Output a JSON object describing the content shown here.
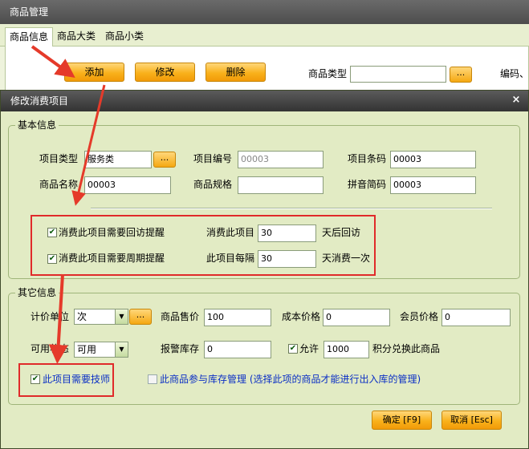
{
  "bg_window": {
    "title": "商品管理",
    "tabs": [
      "商品信息",
      "商品大类",
      "商品小类"
    ],
    "buttons": {
      "add": "添加",
      "edit": "修改",
      "delete": "删除"
    },
    "type_label": "商品类型",
    "code_label": "编码、",
    "dots": "..."
  },
  "dialog": {
    "title": "修改消费项目",
    "close": "×",
    "basic": {
      "title": "基本信息",
      "item_type_label": "项目类型",
      "item_type_value": "服务类",
      "item_no_label": "项目编号",
      "item_no_value": "00003",
      "barcode_label": "项目条码",
      "barcode_value": "00003",
      "name_label": "商品名称",
      "name_value": "00003",
      "spec_label": "商品规格",
      "spec_value": "",
      "pinyin_label": "拼音简码",
      "pinyin_value": "00003",
      "dots": "...",
      "revisit_check": "消费此项目需要回访提醒",
      "revisit_prefix": "消费此项目",
      "revisit_value": "30",
      "revisit_suffix": "天后回访",
      "cycle_check": "消费此项目需要周期提醒",
      "cycle_prefix": "此项目每隔",
      "cycle_value": "30",
      "cycle_suffix": "天消费一次"
    },
    "other": {
      "title": "其它信息",
      "unit_label": "计价单位",
      "unit_value": "次",
      "price_label": "商品售价",
      "price_value": "100",
      "cost_label": "成本价格",
      "cost_value": "0",
      "member_label": "会员价格",
      "member_value": "0",
      "status_label": "可用状态",
      "status_value": "可用",
      "alarm_label": "报警库存",
      "alarm_value": "0",
      "allow_label": "允许",
      "allow_value": "1000",
      "points_label": "积分兑换此商品",
      "tech_check": "此项目需要技师",
      "stock_check": "此商品参与库存管理 (选择此项的商品才能进行出入库的管理)",
      "dots": "..."
    },
    "ok": "确定 [F9]",
    "cancel": "取消 [Esc]"
  }
}
